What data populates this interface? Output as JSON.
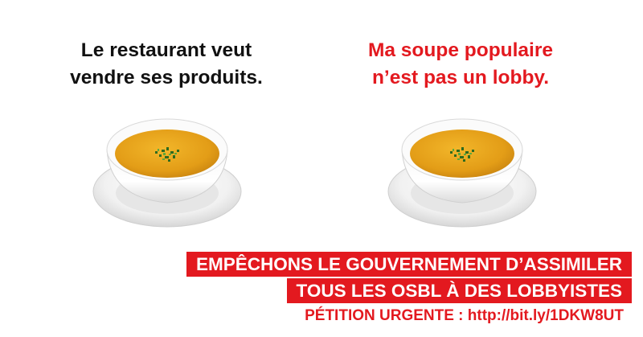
{
  "left_panel": {
    "line1": "Le restaurant veut",
    "line2": "vendre ses produits."
  },
  "right_panel": {
    "line1": "Ma soupe populaire",
    "line2": "n’est pas un lobby."
  },
  "images": {
    "left": "soup-bowl",
    "right": "soup-bowl"
  },
  "banner": {
    "line1": "EMPÊCHONS LE GOUVERNEMENT D’ASSIMILER",
    "line2": "TOUS LES OSBL À DES LOBBYISTES"
  },
  "petition": "PÉTITION URGENTE : http://bit.ly/1DKW8UT",
  "colors": {
    "accent_red": "#e3191f",
    "text_dark": "#111111",
    "soup": "#e9a318"
  }
}
